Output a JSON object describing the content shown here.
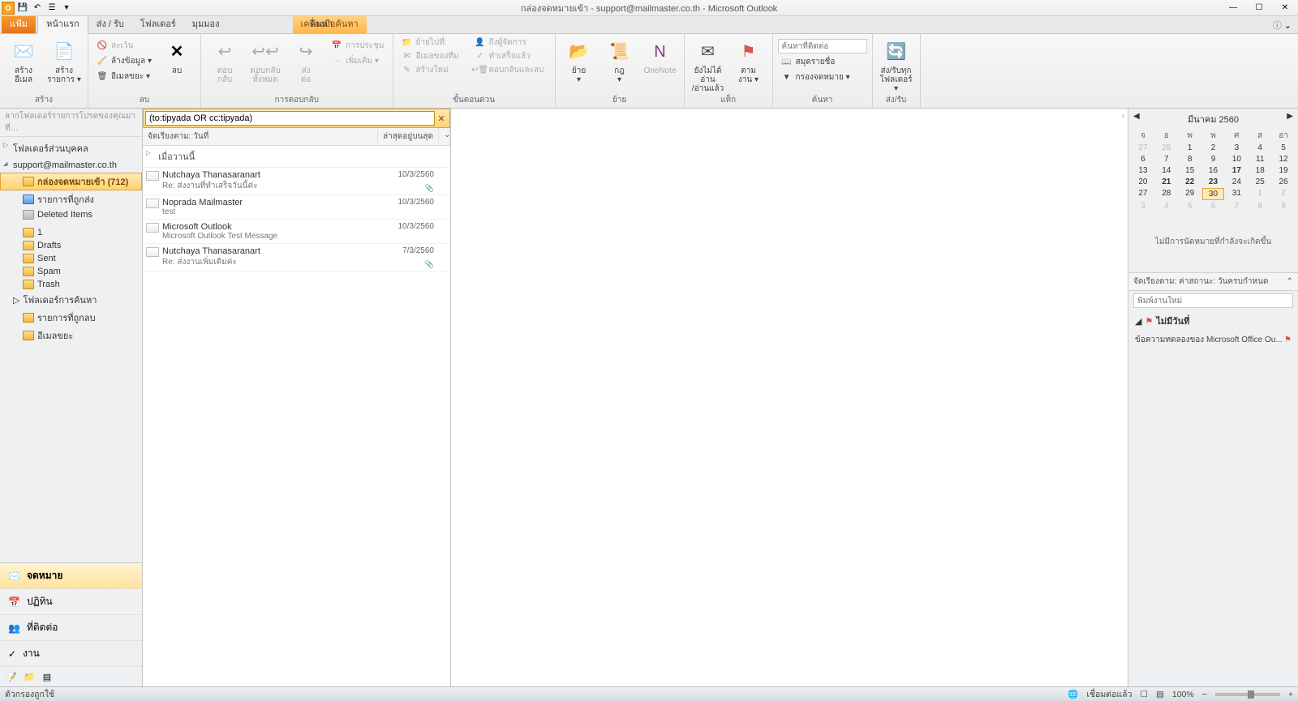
{
  "window": {
    "title": "กล่องจดหมายเข้า - support@mailmaster.co.th - Microsoft Outlook"
  },
  "tabs": {
    "file": "แฟ้ม",
    "home": "หน้าแรก",
    "sendrecv": "ส่ง / รับ",
    "folder": "โฟลเดอร์",
    "view": "มุมมอง",
    "search": "ค้นหา",
    "contextual": "เครื่องมือค้นหา"
  },
  "ribbon": {
    "new": {
      "mail": "สร้าง\nอีเมล",
      "items": "สร้าง\nรายการ ▾",
      "group": "สร้าง"
    },
    "delete": {
      "ignore": "ละเว้น",
      "clean": "ล้างข้อมูล ▾",
      "junk": "อีเมลขยะ ▾",
      "delete": "ลบ",
      "group": "ลบ"
    },
    "respond": {
      "reply": "ตอบ\nกลับ",
      "replyall": "ตอบกลับ\nทั้งหมด",
      "forward": "ส่ง\nต่อ",
      "meeting": "การประชุม",
      "more": "เพิ่มเติม ▾",
      "group": "การตอบกลับ"
    },
    "quick": {
      "moveto": "ย้ายไปที่:",
      "team": "อีเมลของทีม",
      "create": "สร้างใหม่",
      "mgr": "ถึงผู้จัดการ",
      "done": "ทำเสร็จแล้ว",
      "replydel": "ตอบกลับและลบ",
      "group": "ขั้นตอนด่วน"
    },
    "move": {
      "move": "ย้าย\n▾",
      "rules": "กฎ\n▾",
      "onenote": "OneNote",
      "group": "ย้าย"
    },
    "tags": {
      "unread": "ยังไม่ได้อ่าน\n/อ่านแล้ว",
      "follow": "ตาม\nงาน ▾",
      "group": "แท็ก"
    },
    "find": {
      "contact": "ค้นหาที่ติดต่อ",
      "book": "สมุดรายชื่อ",
      "filter": "กรองจดหมาย ▾",
      "group": "ค้นหา"
    },
    "sendall": {
      "btn": "ส่ง/รับทุก\nโฟลเดอร์ ▾",
      "group": "ส่ง/รับ"
    }
  },
  "nav": {
    "hint": "ลากโฟลเดอร์รายการโปรดของคุณมาที่…",
    "personal": "โฟลเดอร์ส่วนบุคคล",
    "account": "support@mailmaster.co.th",
    "folders": {
      "inbox": "กล่องจดหมายเข้า (712)",
      "sentitems": "รายการที่ถูกส่ง",
      "deleted": "Deleted Items",
      "one": "1",
      "drafts": "Drafts",
      "sent": "Sent",
      "spam": "Spam",
      "trash": "Trash",
      "search": "โฟลเดอร์การค้นหา",
      "allitems": "รายการที่ถูกลบ",
      "junk": "อีเมลขยะ"
    },
    "mail": "จดหมาย",
    "calendar": "ปฏิทิน",
    "contacts": "ที่ติดต่อ",
    "tasks": "งาน"
  },
  "search": {
    "query": "(to:tipyada OR cc:tipyada)"
  },
  "listHeader": {
    "arrange": "จัดเรียงตาม: วันที่",
    "newest": "ล่าสุดอยู่บนสุด"
  },
  "groups": {
    "g1": "เมื่อวานนี้"
  },
  "messages": [
    {
      "from": "Nutchaya Thanasaranart",
      "date": "10/3/2560",
      "subj": "Re: ส่งงานที่ทำเสร็จวันนี้ค่ะ",
      "attach": true
    },
    {
      "from": "Noprada Mailmaster",
      "date": "10/3/2560",
      "subj": "test",
      "attach": false
    },
    {
      "from": "Microsoft Outlook",
      "date": "10/3/2560",
      "subj": "Microsoft Outlook Test Message",
      "attach": false
    },
    {
      "from": "Nutchaya Thanasaranart",
      "date": "7/3/2560",
      "subj": "Re: ส่งงานเพิ่มเติมค่ะ",
      "attach": true
    }
  ],
  "calendar": {
    "month": "มีนาคม 2560",
    "dow": [
      "จ",
      "อ",
      "พ",
      "พ",
      "ศ",
      "ส",
      "อา"
    ],
    "weeks": [
      [
        {
          "n": "27",
          "o": true
        },
        {
          "n": "28",
          "o": true
        },
        {
          "n": "1"
        },
        {
          "n": "2"
        },
        {
          "n": "3"
        },
        {
          "n": "4"
        },
        {
          "n": "5"
        }
      ],
      [
        {
          "n": "6"
        },
        {
          "n": "7"
        },
        {
          "n": "8"
        },
        {
          "n": "9"
        },
        {
          "n": "10"
        },
        {
          "n": "11"
        },
        {
          "n": "12"
        }
      ],
      [
        {
          "n": "13"
        },
        {
          "n": "14"
        },
        {
          "n": "15"
        },
        {
          "n": "16"
        },
        {
          "n": "17",
          "b": true
        },
        {
          "n": "18"
        },
        {
          "n": "19"
        }
      ],
      [
        {
          "n": "20"
        },
        {
          "n": "21",
          "b": true
        },
        {
          "n": "22",
          "b": true
        },
        {
          "n": "23",
          "b": true
        },
        {
          "n": "24"
        },
        {
          "n": "25"
        },
        {
          "n": "26"
        }
      ],
      [
        {
          "n": "27"
        },
        {
          "n": "28"
        },
        {
          "n": "29"
        },
        {
          "n": "30",
          "t": true
        },
        {
          "n": "31"
        },
        {
          "n": "1",
          "o": true
        },
        {
          "n": "2",
          "o": true
        }
      ],
      [
        {
          "n": "3",
          "o": true
        },
        {
          "n": "4",
          "o": true
        },
        {
          "n": "5",
          "o": true
        },
        {
          "n": "6",
          "o": true
        },
        {
          "n": "7",
          "o": true
        },
        {
          "n": "8",
          "o": true
        },
        {
          "n": "9",
          "o": true
        }
      ]
    ],
    "noappt": "ไม่มีการนัดหมายที่กำลังจะเกิดขึ้น"
  },
  "tasks": {
    "header": "จัดเรียงตาม: ค่าสถานะ: วันครบกำหนด",
    "placeholder": "พิมพ์งานใหม่",
    "nodate": "ไม่มีวันที่",
    "testmsg": "ข้อความทดลองของ Microsoft Office Ou..."
  },
  "status": {
    "left": "ตัวกรองถูกใช้",
    "connected": "เชื่อมต่อแล้ว",
    "zoom": "100%"
  }
}
